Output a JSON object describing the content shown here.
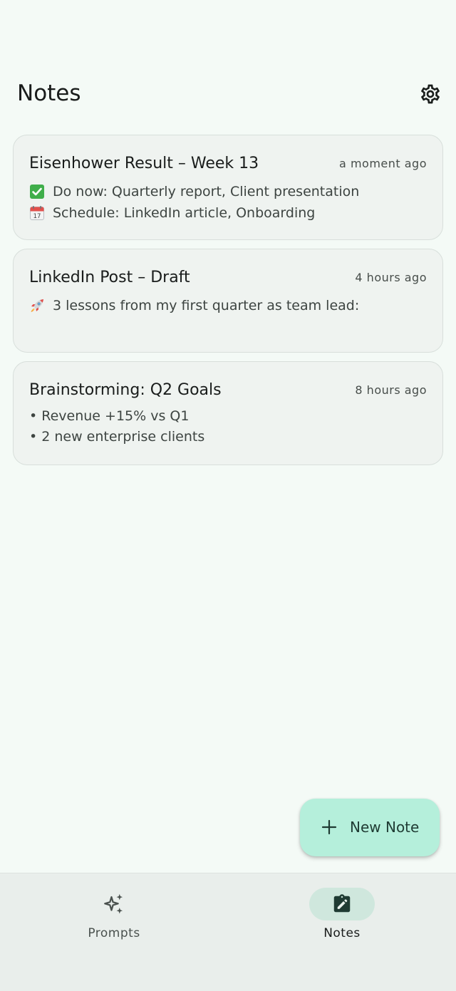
{
  "header": {
    "title": "Notes",
    "settings_icon": "gear-icon"
  },
  "notes": [
    {
      "title": "Eisenhower Result – Week 13",
      "time": "a moment ago",
      "lines": [
        {
          "icon": "check-mark-emoji",
          "text": "Do now: Quarterly report, Client presentation"
        },
        {
          "icon": "calendar-emoji",
          "text": "Schedule: LinkedIn article, Onboarding"
        }
      ]
    },
    {
      "title": "LinkedIn Post – Draft",
      "time": "4 hours ago",
      "lines": [
        {
          "icon": "rocket-emoji",
          "text": "3 lessons from my first quarter as team lead:"
        }
      ]
    },
    {
      "title": "Brainstorming: Q2 Goals",
      "time": "8 hours ago",
      "lines": [
        {
          "text": "• Revenue +15% vs Q1"
        },
        {
          "text": "• 2 new enterprise clients"
        }
      ]
    }
  ],
  "fab": {
    "label": "New Note",
    "icon": "plus-icon"
  },
  "bottom_nav": {
    "items": [
      {
        "label": "Prompts",
        "icon": "sparkles-icon",
        "selected": false
      },
      {
        "label": "Notes",
        "icon": "clipboard-edit-icon",
        "selected": true
      }
    ]
  },
  "colors": {
    "background": "#f4faf6",
    "card": "#eff3f0",
    "fab": "#b5efdb",
    "nav_indicator": "#cfe7dd",
    "check_green": "#3fae4a"
  }
}
